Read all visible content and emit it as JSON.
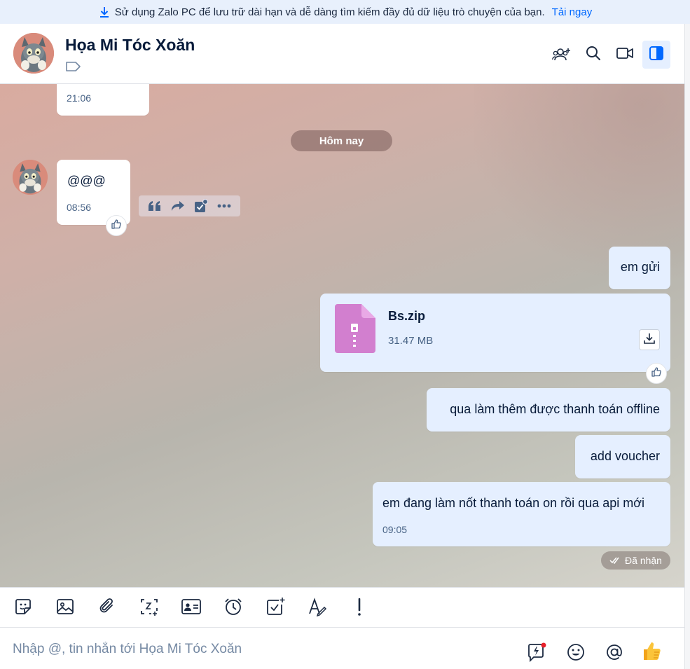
{
  "banner": {
    "text": "Sử dụng Zalo PC để lưu trữ dài hạn và dễ dàng tìm kiếm đầy đủ dữ liệu trò chuyện của bạn.",
    "link": "Tải ngay"
  },
  "header": {
    "name": "Họa Mi Tóc Xoăn"
  },
  "chat": {
    "prev_time": "21:06",
    "date_divider": "Hôm nay",
    "incoming": {
      "text": "@@@",
      "time": "08:56"
    },
    "outgoing": [
      {
        "text": "em gửi"
      },
      {
        "text": "qua làm thêm được thanh toán offline"
      },
      {
        "text": "add voucher"
      },
      {
        "text": "em đang làm nốt thanh toán on rồi qua api mới",
        "time": "09:05"
      }
    ],
    "file": {
      "name": "Bs.zip",
      "size": "31.47 MB"
    },
    "status": "Đã nhận"
  },
  "composer": {
    "placeholder": "Nhập @, tin nhắn tới Họa Mi Tóc Xoăn"
  },
  "colors": {
    "accent": "#0068ff",
    "outgoing_bubble": "#e5efff",
    "file_icon": "#d27fcf"
  }
}
